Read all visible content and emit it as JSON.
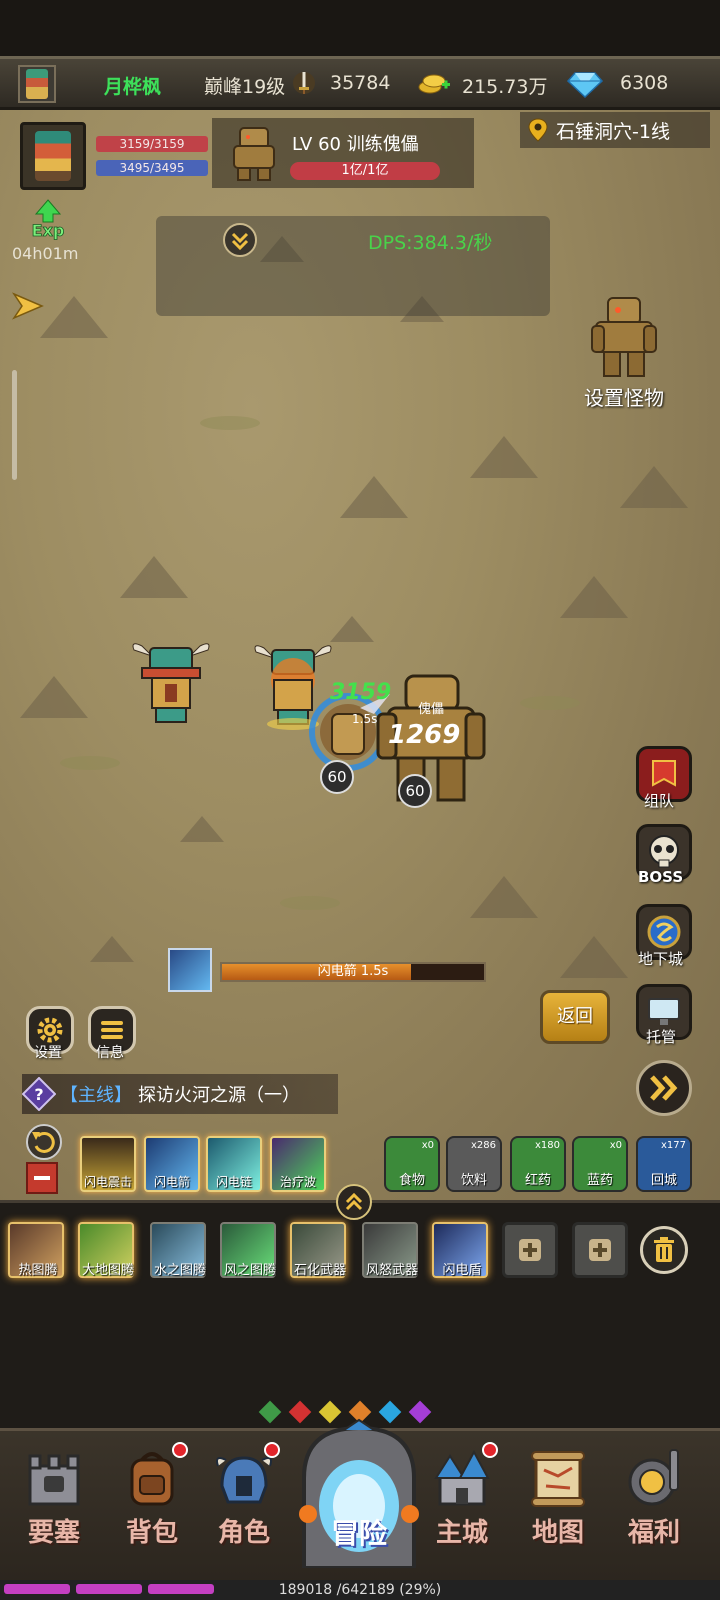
{
  "topbar": {
    "player_name": "月桦枫",
    "peak_level": "巅峰19级",
    "power": "35784",
    "gold": "215.73万",
    "gems": "6308"
  },
  "player": {
    "hp": "3159/3159",
    "mp": "3495/3495"
  },
  "monster": {
    "title": "LV 60 训练傀儡",
    "hp": "1亿/1亿"
  },
  "location": "石锤洞穴-1线",
  "exp_timer": "04h01m",
  "exp_icon_label": "Exp",
  "dps": "DPS:384.3/秒",
  "set_monster": "设置怪物",
  "battle": {
    "heal_number": "3159",
    "damage_number": "1269",
    "cooldown": "1.5s",
    "golem_name": "傀儡",
    "hero_level": "60",
    "golem_level": "60"
  },
  "side_buttons": [
    {
      "label": "组队",
      "icon": "banner-icon"
    },
    {
      "label": "BOSS",
      "icon": "skull-icon"
    },
    {
      "label": "地下城",
      "icon": "portal-icon"
    },
    {
      "label": "托管",
      "icon": "monitor-icon"
    }
  ],
  "cast": {
    "text": "闪电箭 1.5s",
    "progress": 0.72
  },
  "left_buttons": [
    {
      "label": "设置",
      "icon": "gear-icon"
    },
    {
      "label": "信息",
      "icon": "menu-icon"
    }
  ],
  "return_label": "返回",
  "quest": {
    "tag": "【主线】",
    "text": "探访火河之源（一）"
  },
  "skills": [
    {
      "label": "闪电震击"
    },
    {
      "label": "闪电箭"
    },
    {
      "label": "闪电链"
    },
    {
      "label": "治疗波"
    }
  ],
  "items": [
    {
      "label": "食物",
      "count": "x0"
    },
    {
      "label": "饮料",
      "count": "x286"
    },
    {
      "label": "红药",
      "count": "x180"
    },
    {
      "label": "蓝药",
      "count": "x0"
    },
    {
      "label": "回城",
      "count": "x177"
    }
  ],
  "totems": [
    {
      "label": "热图腾"
    },
    {
      "label": "大地图腾"
    },
    {
      "label": "水之图腾"
    },
    {
      "label": "风之图腾"
    },
    {
      "label": "石化武器"
    },
    {
      "label": "风怒武器"
    },
    {
      "label": "闪电盾"
    }
  ],
  "dot_colors": [
    "#3f9a47",
    "#d33232",
    "#d9c533",
    "#e0802a",
    "#2aa6e0",
    "#a43ed6"
  ],
  "nav": [
    {
      "label": "要塞",
      "badge": false
    },
    {
      "label": "背包",
      "badge": true
    },
    {
      "label": "角色",
      "badge": true
    },
    {
      "label": "冒险",
      "badge": false
    },
    {
      "label": "主城",
      "badge": true
    },
    {
      "label": "地图",
      "badge": false
    },
    {
      "label": "福利",
      "badge": false
    }
  ],
  "exp_progress": {
    "text": "189018 /642189 (29%)",
    "fraction": 0.29
  }
}
